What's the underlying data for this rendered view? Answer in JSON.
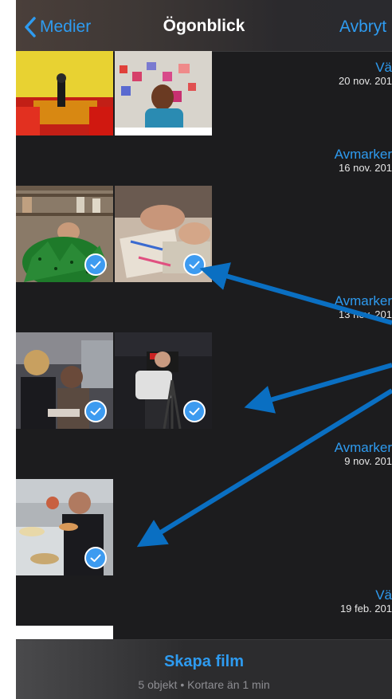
{
  "nav": {
    "back_label": "Medier",
    "title": "Ögonblick",
    "cancel_label": "Avbryt"
  },
  "sections": [
    {
      "action": "Vä",
      "date": "20 nov. 201"
    },
    {
      "action": "Avmarker",
      "date": "16 nov. 201"
    },
    {
      "action": "Avmarker",
      "date": "13 nov. 201"
    },
    {
      "action": "Avmarker",
      "date": "9 nov. 201"
    },
    {
      "action": "Vä",
      "date": "19 feb. 201"
    }
  ],
  "bottom": {
    "button_label": "Skapa film",
    "summary": "5 objekt • Kortare än 1 min"
  },
  "colors": {
    "accent": "#2e9bf0",
    "check": "#3d9bf0",
    "annotation_arrow": "#0a6fc2",
    "background": "#1c1c1e"
  }
}
